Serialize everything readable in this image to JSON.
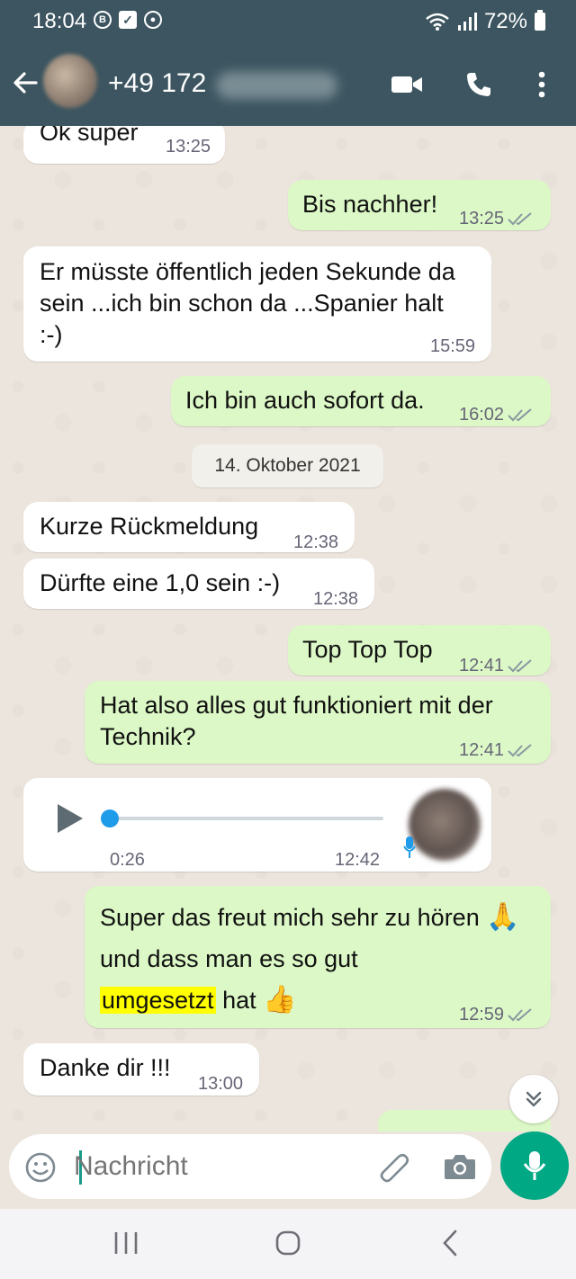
{
  "status_bar": {
    "time": "18:04",
    "battery": "72%",
    "icons": [
      "b-icon",
      "check-box-icon",
      "sync-icon",
      "wifi-icon",
      "signal-icon",
      "battery-icon"
    ]
  },
  "header": {
    "contact": "+49 172",
    "icons": [
      "back-arrow-icon",
      "video-call-icon",
      "phone-icon",
      "more-icon"
    ]
  },
  "messages": [
    {
      "dir": "in",
      "text": "Ok super",
      "time": "13:25"
    },
    {
      "dir": "out",
      "text": "Bis nachher!",
      "time": "13:25"
    },
    {
      "dir": "in",
      "text": "Er müsste öffentlich jeden Sekunde da sein ...ich bin schon da ...Spanier halt :-)",
      "time": "15:59"
    },
    {
      "dir": "out",
      "text": "Ich bin auch sofort da.",
      "time": "16:02"
    },
    {
      "dir": "in",
      "text": "Kurze Rückmeldung",
      "time": "12:38"
    },
    {
      "dir": "in",
      "text": "Dürfte eine 1,0 sein :-)",
      "time": "12:38"
    },
    {
      "dir": "out",
      "text": "Top Top Top",
      "time": "12:41"
    },
    {
      "dir": "out",
      "text": "Hat also alles gut funktioniert mit der Technik?",
      "time": "12:41"
    },
    {
      "dir": "in",
      "type": "voice",
      "duration": "0:26",
      "time": "12:42",
      "progress": 0
    },
    {
      "dir": "out",
      "text_part1": "Super das freut mich sehr zu hören",
      "emoji1": "🙏",
      "text_part2": "und dass man es so gut",
      "highlight": "umgesetzt",
      "text_part3": "hat",
      "emoji2": "👍",
      "time": "12:59"
    },
    {
      "dir": "in",
      "text": "Danke dir !!!",
      "time": "13:00"
    }
  ],
  "date_divider": "14. Oktober 2021",
  "input": {
    "placeholder": "Nachricht",
    "icons": [
      "emoji-icon",
      "attach-icon",
      "camera-icon",
      "mic-icon"
    ]
  },
  "colors": {
    "header": "#3c5560",
    "chat_bg": "#ece5dd",
    "bubble_out": "#dcf8c6",
    "bubble_in": "#ffffff",
    "accent": "#00a884",
    "highlight": "#ffff00"
  }
}
